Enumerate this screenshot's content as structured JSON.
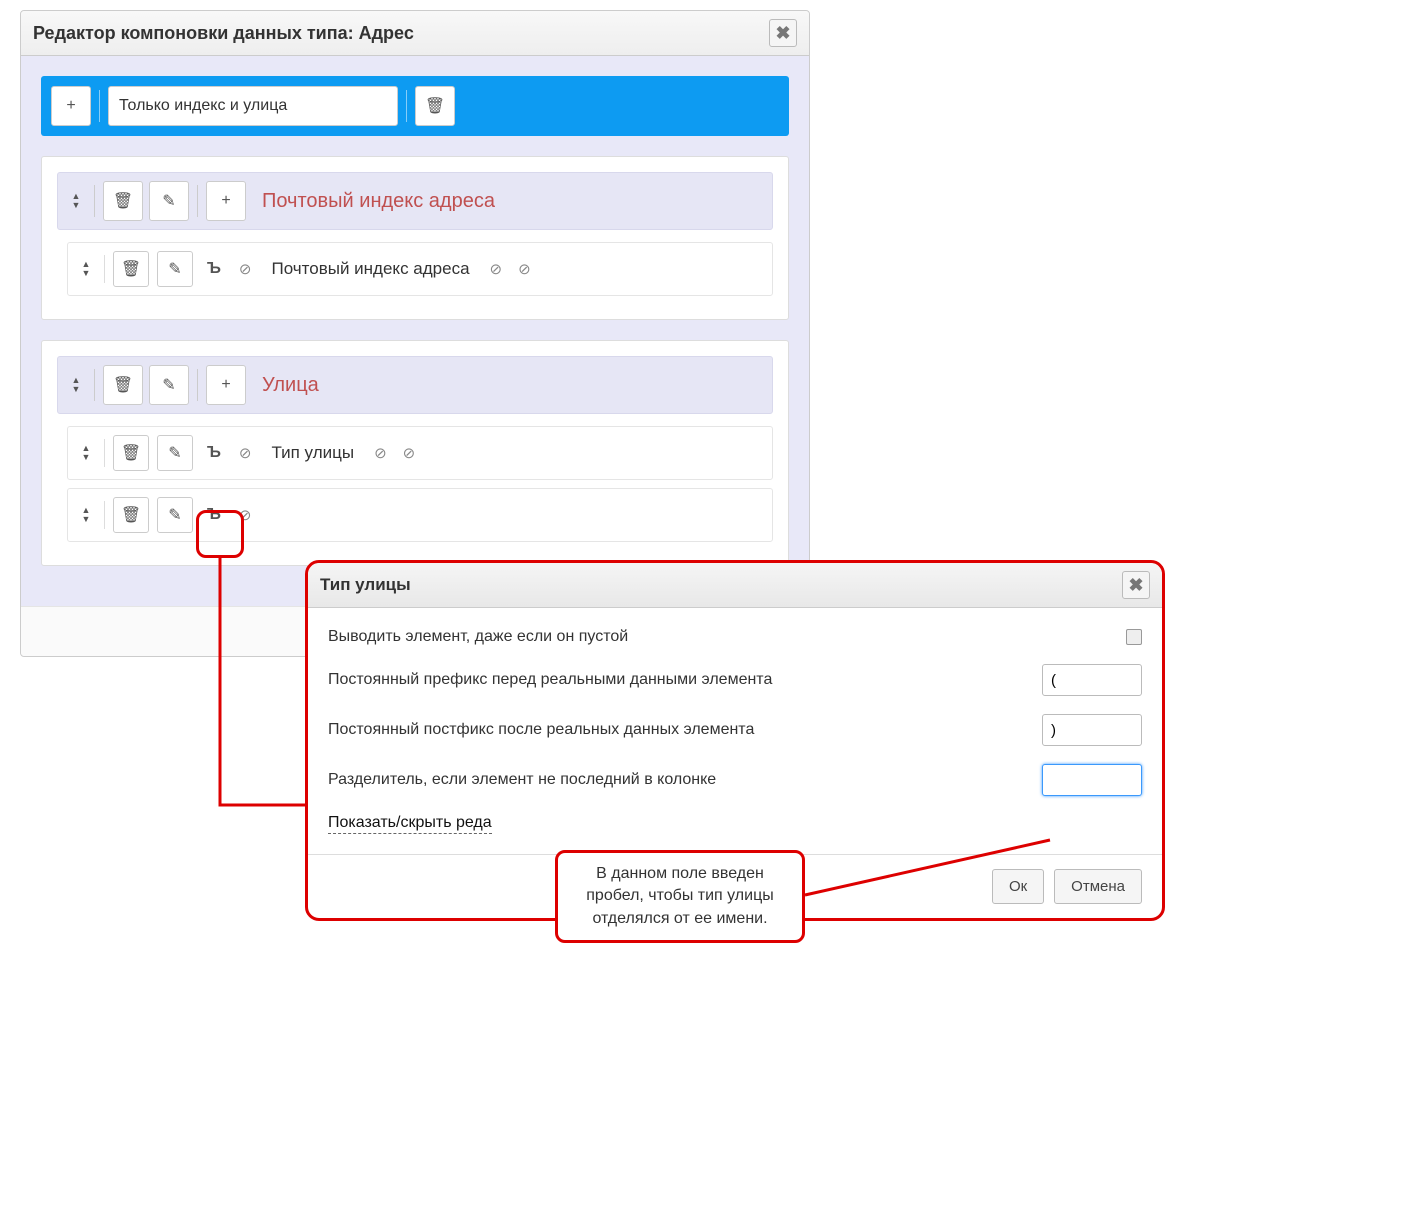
{
  "main": {
    "title": "Редактор компоновки данных типа: Адрес",
    "layout_name": "Только индекс и улица",
    "sections": [
      {
        "title": "Почтовый индекс адреса",
        "rows": [
          {
            "label": "Почтовый индекс адреса"
          }
        ]
      },
      {
        "title": "Улица",
        "rows": [
          {
            "label": "Тип улицы"
          },
          {
            "label": ""
          }
        ]
      }
    ]
  },
  "dialog": {
    "title": "Тип улицы",
    "fields": {
      "show_empty_label": "Выводить элемент, даже если он пустой",
      "prefix_label": "Постоянный префикс перед реальными данными элемента",
      "prefix_value": "(",
      "postfix_label": "Постоянный постфикс после реальных данных элемента",
      "postfix_value": ")",
      "separator_label": "Разделитель, если элемент не последний в колонке",
      "separator_value": " "
    },
    "toggle_text": "Показать/скрыть реда",
    "ok": "Ок",
    "cancel": "Отмена"
  },
  "callout": {
    "text": "В данном поле введен пробел, чтобы тип улицы отделялся от ее имени."
  }
}
